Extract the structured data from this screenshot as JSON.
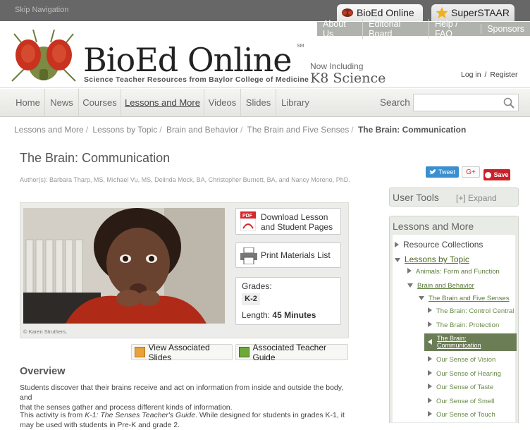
{
  "topbar": {
    "skip_nav": "Skip Navigation",
    "tab_bioed": "BioEd Online",
    "tab_superstaar": "SuperSTAAR"
  },
  "header_links": [
    "About Us",
    "Editorial Board",
    "Help / FAQ",
    "Sponsors"
  ],
  "brand": {
    "name": "BioEd Online",
    "trademark": "SM",
    "tagline": "Science Teacher Resources from Baylor College of Medicine",
    "now_including": "Now Including",
    "k8": "K8 Science",
    "login": "Log in",
    "login_sep": "/",
    "register": "Register"
  },
  "nav": {
    "items": [
      "Home",
      "News",
      "Courses",
      "Lessons and More",
      "Videos",
      "Slides",
      "Library"
    ],
    "search_label": "Search"
  },
  "breadcrumbs": [
    "Lessons and More",
    "Lessons by Topic",
    "Brain and Behavior",
    "The Brain and Five Senses",
    "The Brain: Communication"
  ],
  "page": {
    "title": "The Brain: Communication",
    "authors": "Author(s): Barbara Tharp, MS, Michael Vu, MS, Delinda Mock, BA, Christopher Burnett, BA, and Nancy Moreno, PhD."
  },
  "social": {
    "tweet": "Tweet",
    "gplus": "G+",
    "save": "Save"
  },
  "lesson": {
    "photo_credit": "© Karen Struthers.",
    "download_l1": "Download Lesson",
    "download_l2": "and Student Pages",
    "pdf_label": "PDF",
    "print": "Print Materials List",
    "grades_label": "Grades:",
    "grades_value": "K-2",
    "length_label": "Length:",
    "length_value": "45 Minutes",
    "view_slides": "View Associated Slides",
    "teacher_guide": "Associated Teacher Guide"
  },
  "overview": {
    "heading": "Overview",
    "p1_l1": "Students discover that their brains receive and act on information from inside and outside the body, and",
    "p1_l2": "that the senses gather and process different kinds of information.",
    "p2_pre": "This activity is from ",
    "p2_em": "K-1: The Senses Teacher's Guide",
    "p2_post": ". While designed for students in grades K-1, it",
    "p2_l2": "may be used with students in Pre-K and grade 2."
  },
  "sidebar": {
    "user_tools": "User Tools",
    "expand": "[+] Expand",
    "lessons_head": "Lessons and More",
    "tree": [
      {
        "label": "Resource Collections"
      },
      {
        "label": "Lessons by Topic"
      },
      {
        "label": "Animals: Form and Function"
      },
      {
        "label": "Brain and Behavior"
      },
      {
        "label": "The Brain and Five Senses"
      },
      {
        "label": "The Brain: Control Central"
      },
      {
        "label": "The Brain: Protection"
      },
      {
        "label": "The Brain: Communication"
      },
      {
        "label": "Our Sense of Vision"
      },
      {
        "label": "Our Sense of Hearing"
      },
      {
        "label": "Our Sense of Taste"
      },
      {
        "label": "Our Sense of Smell"
      },
      {
        "label": "Our Sense of Touch"
      }
    ]
  },
  "colors": {
    "accent_green": "#6b7d55",
    "link_green": "#4e6a1f",
    "save_red": "#cb2027",
    "tweet_blue": "#3a8fd0"
  }
}
